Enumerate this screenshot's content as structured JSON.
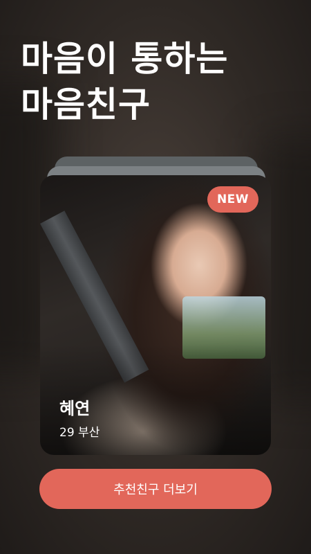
{
  "headline": {
    "line1": "마음이 통하는",
    "line2": "마음친구"
  },
  "card": {
    "badge": "NEW",
    "name": "혜연",
    "meta": "29 부산"
  },
  "cta": {
    "label": "추천친구 더보기"
  },
  "colors": {
    "accent": "#e2675a",
    "background": "#2f2925"
  }
}
